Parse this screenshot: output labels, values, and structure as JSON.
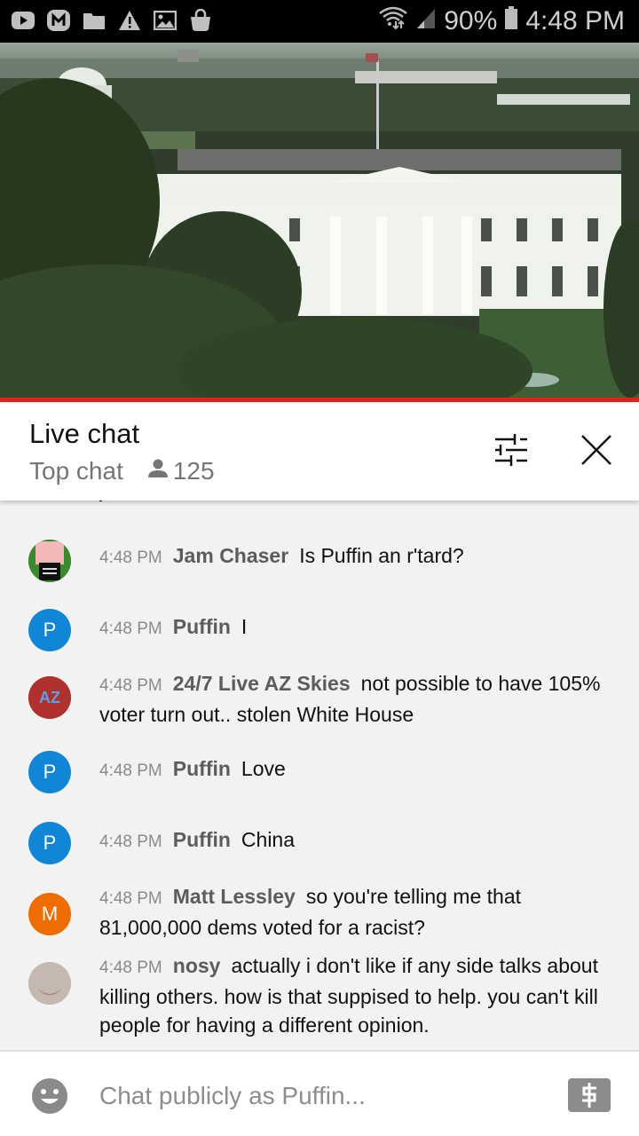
{
  "status_bar": {
    "notification_icons": [
      "youtube-icon",
      "m-app-icon",
      "folder-icon",
      "warning-icon",
      "gallery-icon",
      "shopping-bag-icon"
    ],
    "battery_percent": "90%",
    "time": "4:48 PM"
  },
  "video": {
    "scene": "Live stream of the White House",
    "progress_color": "#e62117"
  },
  "chat_header": {
    "title": "Live chat",
    "mode": "Top chat",
    "viewer_count": "125"
  },
  "messages": [
    {
      "avatar_type": "image",
      "avatar_desc": "Jam Chaser avatar",
      "time": "4:48 PM",
      "author": "Jam Chaser",
      "text": "Is Puffin an r'tard?"
    },
    {
      "avatar_type": "letter",
      "avatar_letter": "P",
      "avatar_color": "#0f86d6",
      "time": "4:48 PM",
      "author": "Puffin",
      "text": "I"
    },
    {
      "avatar_type": "image",
      "avatar_desc": "24/7 Live AZ Skies avatar",
      "avatar_label": "AZ",
      "time": "4:48 PM",
      "author": "24/7 Live AZ Skies",
      "text": "not possible to have 105% voter turn out.. stolen White House"
    },
    {
      "avatar_type": "letter",
      "avatar_letter": "P",
      "avatar_color": "#0f86d6",
      "time": "4:48 PM",
      "author": "Puffin",
      "text": "Love"
    },
    {
      "avatar_type": "letter",
      "avatar_letter": "P",
      "avatar_color": "#0f86d6",
      "time": "4:48 PM",
      "author": "Puffin",
      "text": "China"
    },
    {
      "avatar_type": "letter",
      "avatar_letter": "M",
      "avatar_color": "#ef6c00",
      "time": "4:48 PM",
      "author": "Matt Lessley",
      "text": "so you're telling me that 81,000,000 dems voted for a racist?"
    },
    {
      "avatar_type": "image",
      "avatar_desc": "nosy avatar",
      "time": "4:48 PM",
      "author": "nosy",
      "text": "actually i don't like if any side talks about killing others. how is that suppised to help. you can't kill people for having a different opinion."
    }
  ],
  "input_bar": {
    "placeholder": "Chat publicly as Puffin...",
    "emoji_icon": "emoji-icon",
    "superchat_icon": "dollar-icon"
  }
}
